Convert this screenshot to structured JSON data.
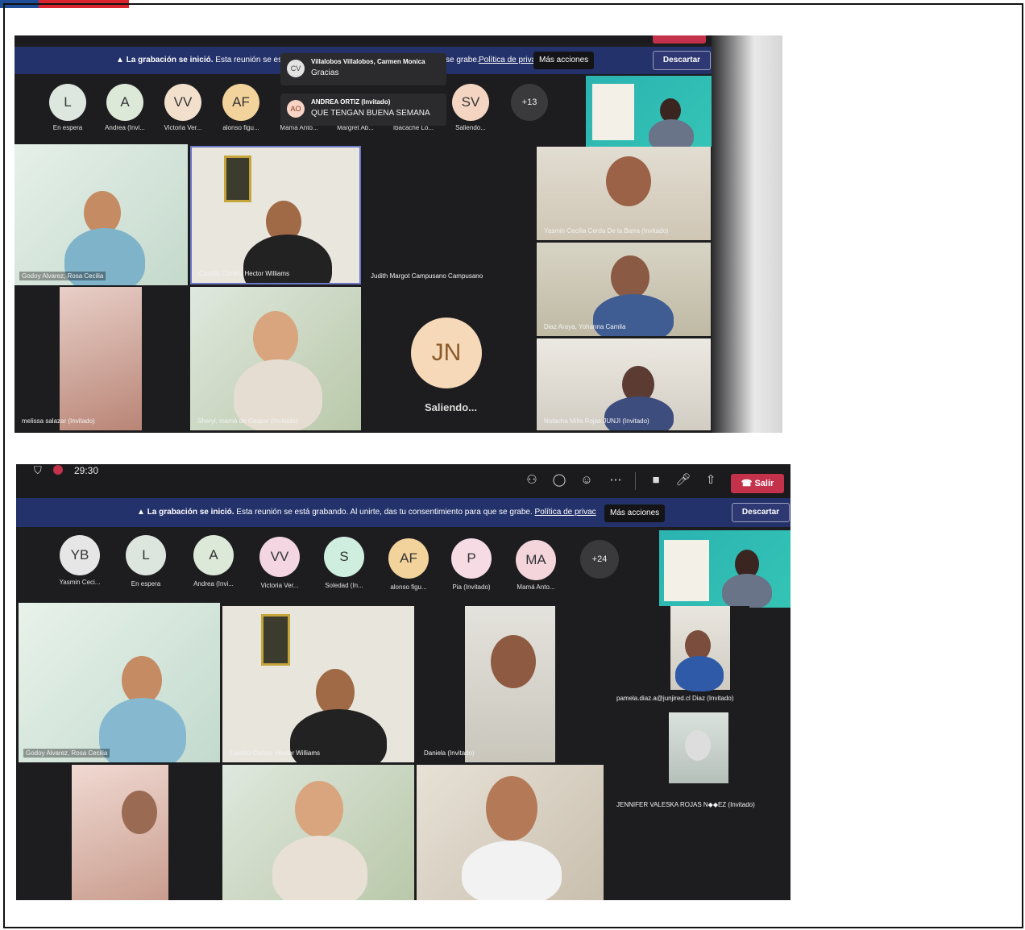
{
  "colors": {
    "accent_red": "#c4314b",
    "recording_bar": "#24326b",
    "background": "#1d1d1f"
  },
  "screenshot1": {
    "recording": {
      "title": "La grabación se inició.",
      "text": "Esta reunión se está g",
      "text_tail": "se grabe.",
      "policy_link": "Política de privac",
      "tooltip": "Más acciones",
      "dismiss": "Descartar"
    },
    "toasts": [
      {
        "initials": "CV",
        "name": "Villalobos Villalobos, Carmen Monica",
        "message": "Gracias"
      },
      {
        "initials": "AO",
        "name": "ANDREA ORTIZ (Invitado)",
        "message": "QUE TENGAN BUENA SEMANA"
      }
    ],
    "avatars": [
      {
        "initials": "L",
        "name": "En espera"
      },
      {
        "initials": "A",
        "name": "Andrea (Invi..."
      },
      {
        "initials": "VV",
        "name": "Victoria Ver..."
      },
      {
        "initials": "AF",
        "name": "alonso figu..."
      },
      {
        "initials": "",
        "name": "Mamá Anto..."
      },
      {
        "initials": "",
        "name": "Margret Ab..."
      },
      {
        "initials": "",
        "name": "Ibacache Lo..."
      },
      {
        "initials": "SV",
        "name": "Saliendo..."
      },
      {
        "initials": "+13",
        "name": ""
      }
    ],
    "tiles": {
      "t1": "Godoy Alvarez, Rosa Cecilia",
      "t2": "Castillo Cortés, Hector Williams",
      "t3": "Judith Margot Campusano Campusano",
      "t4": "Yasmin Cecilia Cerda De la Barra (Invitado)",
      "t5": "Diaz Araya, Yohanna Camila",
      "t6": "melissa salazar (Invitado)",
      "t7": "Sheryl, mamá de Gaspar (Invitado)",
      "t8_initials": "JN",
      "t8_status": "Saliendo...",
      "t9": "Natacha Milla Rojas JUNJI (Invitado)"
    }
  },
  "screenshot2": {
    "timer": "29:30",
    "leave": "Salir",
    "recording": {
      "title": "La grabación se inició.",
      "text": "Esta reunión se está grabando. Al unirte, das tu consentimiento para que se grabe.",
      "policy_link": "Política de privac",
      "tooltip": "Más acciones",
      "dismiss": "Descartar"
    },
    "avatars": [
      {
        "initials": "YB",
        "name": "Yasmin Ceci..."
      },
      {
        "initials": "L",
        "name": "En espera"
      },
      {
        "initials": "A",
        "name": "Andrea (Invi..."
      },
      {
        "initials": "VV",
        "name": "Victoria Ver..."
      },
      {
        "initials": "S",
        "name": "Soledad (In..."
      },
      {
        "initials": "AF",
        "name": "alonso figu..."
      },
      {
        "initials": "P",
        "name": "Pia (Invitado)"
      },
      {
        "initials": "MA",
        "name": "Mamá Anto..."
      },
      {
        "initials": "+24",
        "name": ""
      }
    ],
    "tiles": {
      "t1": "Godoy Alvarez, Rosa Cecilia",
      "t2": "Castillo Cortés, Hector Williams",
      "t3": "Daniela (Invitado)",
      "t4": "pamela.diaz.a@junjired.cl Diaz (Invitado)",
      "t5": "JENNIFER VALESKA ROJAS N◆◆EZ (Invitado)"
    }
  }
}
